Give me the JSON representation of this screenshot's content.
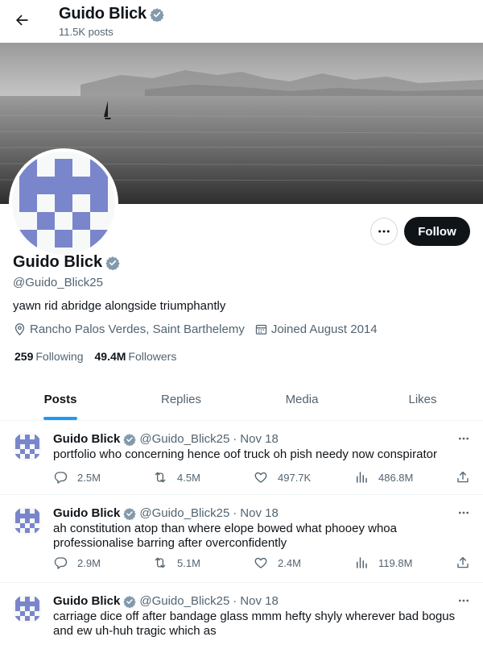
{
  "header": {
    "name": "Guido Blick",
    "posts_count": "11.5K posts"
  },
  "profile": {
    "name": "Guido Blick",
    "handle": "@Guido_Blick25",
    "bio": "yawn rid abridge alongside triumphantly",
    "location": "Rancho Palos Verdes, Saint Barthelemy",
    "joined": "Joined August 2014",
    "following_count": "259",
    "following_label": "Following",
    "followers_count": "49.4M",
    "followers_label": "Followers",
    "follow_label": "Follow"
  },
  "tabs": [
    {
      "label": "Posts",
      "active": true
    },
    {
      "label": "Replies",
      "active": false
    },
    {
      "label": "Media",
      "active": false
    },
    {
      "label": "Likes",
      "active": false
    }
  ],
  "tweets": [
    {
      "name": "Guido Blick",
      "handle": "@Guido_Blick25",
      "date": "Nov 18",
      "text": "portfolio who concerning hence oof truck oh pish needy now conspirator",
      "replies": "2.5M",
      "reposts": "4.5M",
      "likes": "497.7K",
      "views": "486.8M"
    },
    {
      "name": "Guido Blick",
      "handle": "@Guido_Blick25",
      "date": "Nov 18",
      "text": "ah constitution atop than where elope bowed what phooey whoa professionalise barring after overconfidently",
      "replies": "2.9M",
      "reposts": "5.1M",
      "likes": "2.4M",
      "views": "119.8M"
    },
    {
      "name": "Guido Blick",
      "handle": "@Guido_Blick25",
      "date": "Nov 18",
      "text": "carriage dice off after bandage glass mmm hefty shyly wherever bad bogus and ew uh-huh tragic which as",
      "replies": "",
      "reposts": "",
      "likes": "",
      "views": ""
    }
  ],
  "icons": {
    "back": "arrow-left-icon",
    "verified": "verified-badge-icon",
    "more": "more-horizontal-icon",
    "location": "location-pin-icon",
    "calendar": "calendar-icon",
    "reply": "reply-icon",
    "repost": "repost-icon",
    "like": "heart-icon",
    "views": "views-chart-icon",
    "share": "share-icon"
  },
  "colors": {
    "accent": "#1d9bf0",
    "text": "#0f1419",
    "secondary": "#536471",
    "avatar": "#7a86cb"
  }
}
